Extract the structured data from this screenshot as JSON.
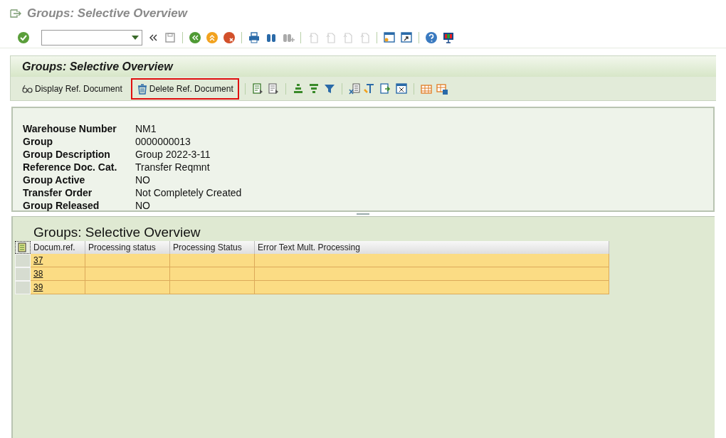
{
  "window": {
    "title": "Groups: Selective Overview"
  },
  "panel": {
    "title": "Groups: Selective Overview"
  },
  "app_toolbar": {
    "buttons": [
      {
        "label": "Display Ref. Document",
        "highlighted": false
      },
      {
        "label": "Delete Ref. Document",
        "highlighted": true
      }
    ]
  },
  "header": {
    "fields": [
      {
        "label": "Warehouse Number",
        "value": "NM1"
      },
      {
        "label": "Group",
        "value": "0000000013"
      },
      {
        "label": "Group Description",
        "value": "Group 2022-3-11"
      },
      {
        "label": "Reference Doc. Cat.",
        "value": "Transfer Reqmnt"
      },
      {
        "label": "Group Active",
        "value": "NO"
      },
      {
        "label": "Transfer Order",
        "value": "Not Completely Created"
      },
      {
        "label": "Group Released",
        "value": "NO"
      }
    ]
  },
  "table": {
    "title": "Groups: Selective Overview",
    "columns": [
      "Docum.ref.",
      "Processing status",
      "Processing Status",
      "Error Text Mult. Processing"
    ],
    "rows": [
      {
        "docum_ref": "37"
      },
      {
        "docum_ref": "38"
      },
      {
        "docum_ref": "39"
      }
    ]
  }
}
